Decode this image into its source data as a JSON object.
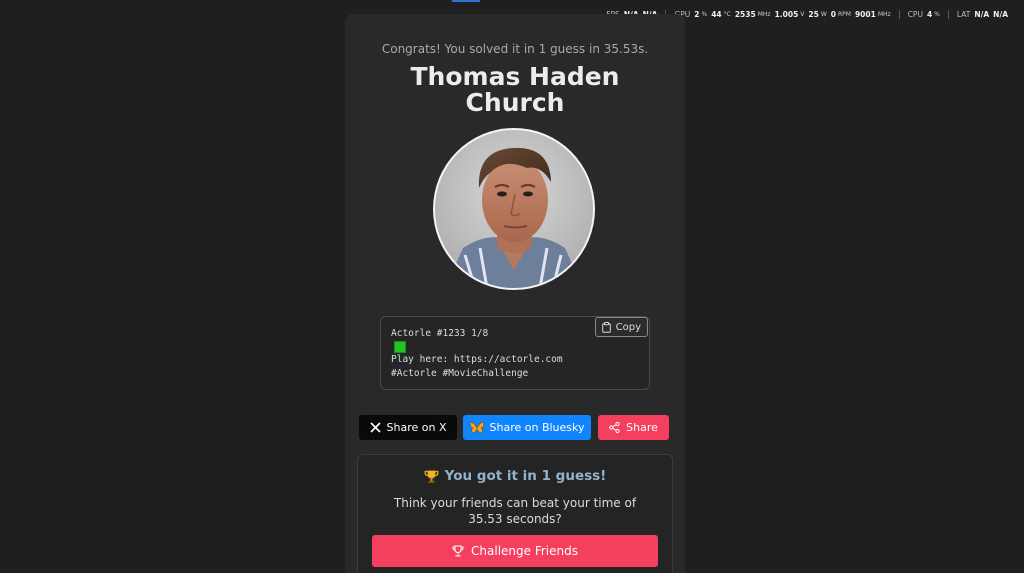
{
  "overlay": {
    "fps": {
      "label": "FPS",
      "values": [
        "N/A",
        "N/A"
      ]
    },
    "gpu": {
      "label": "GPU",
      "load": "2",
      "load_unit": "%",
      "temp": "44",
      "temp_unit": "°C",
      "clock": "2535",
      "clock_unit": "MHz",
      "volt": "1.005",
      "volt_unit": "V",
      "power": "25",
      "power_unit": "W",
      "fan": "0",
      "fan_unit": "RPM",
      "mem_clock": "9001",
      "mem_clock_unit": "MHz"
    },
    "cpu": {
      "label": "CPU",
      "load": "4",
      "load_unit": "%"
    },
    "lat": {
      "label": "LAT",
      "values": [
        "N/A",
        "N/A"
      ]
    }
  },
  "result": {
    "congrats": "Congrats! You solved it in 1 guess in 35.53s.",
    "actor_name": "Thomas Haden Church"
  },
  "share_box": {
    "line1": "Actorle #1233 1/8",
    "line3": "Play here: https://actorle.com",
    "line4": "#Actorle #MovieChallenge",
    "copy_label": "Copy",
    "square_color": "#22c322"
  },
  "share_buttons": {
    "x_label": "Share on X",
    "bluesky_label": "Share on Bluesky",
    "share_label": "Share"
  },
  "challenge": {
    "title": "You got it in 1 guess!",
    "text": "Think your friends can beat your time of 35.53 seconds?",
    "button_label": "Challenge Friends"
  },
  "colors": {
    "background": "#1f1f1f",
    "card": "#2a2929",
    "accent_pink": "#f43f5e",
    "bluesky_blue": "#1185fe",
    "x_black": "#0a0a0a"
  }
}
